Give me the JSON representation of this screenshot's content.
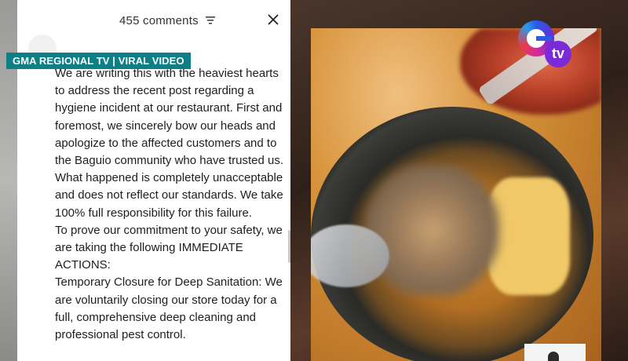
{
  "comments": {
    "count_label": "455 comments"
  },
  "broadcast": {
    "label": "GMA REGIONAL TV | VIRAL VIDEO",
    "logo_text": "tv",
    "accent": "#0e7f86"
  },
  "post": {
    "paragraphs": [
      "We are writing this with the heaviest hearts to address the recent post regarding a hygiene incident at our restaurant. First and foremost, we sincerely bow our heads and apologize to the affected customers and to the Baguio community who have trusted us.",
      " What happened is completely unacceptable and does not reflect our standards. We take 100% full responsibility for this failure.",
      " To prove our commitment to your safety, we are taking the following IMMEDIATE ACTIONS:",
      " Temporary Closure for Deep Sanitation: We are voluntarily closing our store today for a full, comprehensive deep cleaning and professional pest control."
    ]
  },
  "icons": {
    "filter": "filter-icon",
    "close": "close-icon"
  }
}
